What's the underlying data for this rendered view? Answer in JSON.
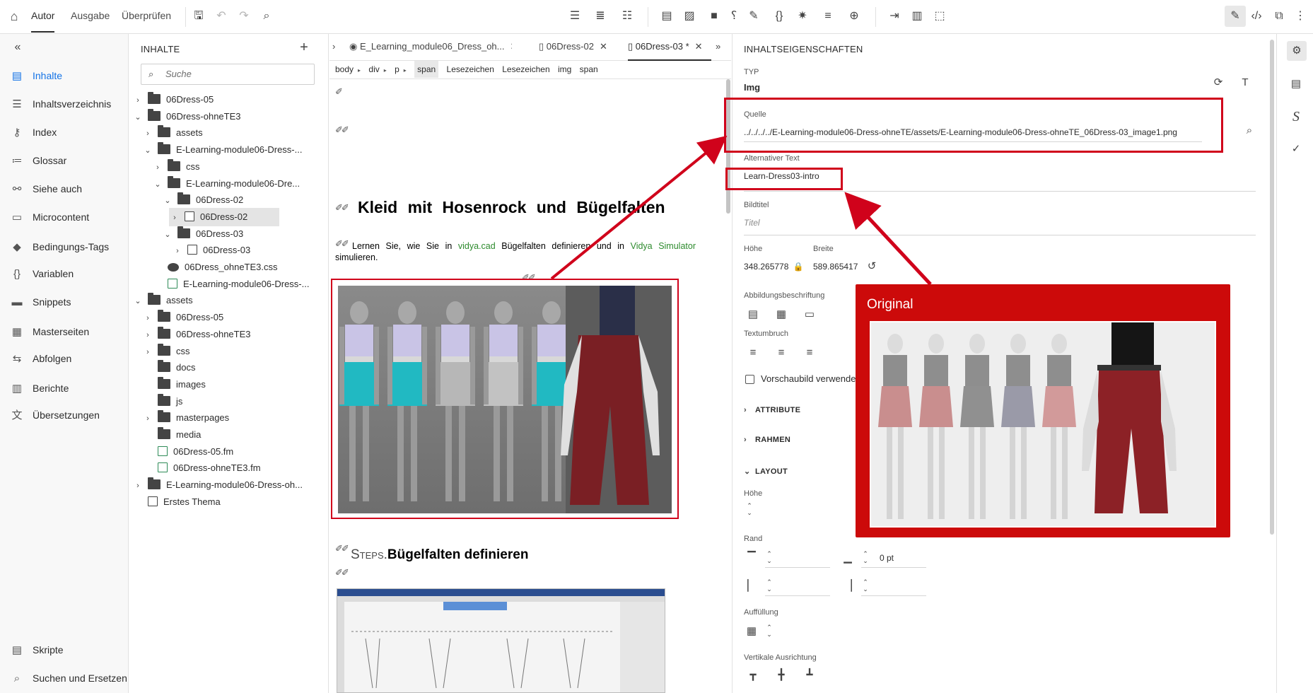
{
  "topbar": {
    "modes": [
      "Autor",
      "Ausgabe",
      "Überprüfen"
    ],
    "icons": [
      "home-icon",
      "save-icon",
      "undo-icon",
      "redo-icon",
      "find-replace-icon",
      "bullet-list-icon",
      "numbered-list-icon",
      "outdent-list-icon",
      "insert-table-icon",
      "insert-image-icon",
      "insert-video-icon",
      "insert-symbol-icon",
      "insert-link-icon",
      "insert-variable-icon",
      "insert-snippet-icon",
      "insert-gallery-icon",
      "add-circle-icon",
      "indent-icon",
      "page-layout-icon",
      "crop-icon",
      "edit-pencil-icon",
      "code-view-icon",
      "preview-icon",
      "more-icon"
    ]
  },
  "leftnav": {
    "items": [
      {
        "label": "Inhalte",
        "icon": "content-icon"
      },
      {
        "label": "Inhaltsverzeichnis",
        "icon": "toc-icon"
      },
      {
        "label": "Index",
        "icon": "key-icon"
      },
      {
        "label": "Glossar",
        "icon": "glossary-icon"
      },
      {
        "label": "Siehe auch",
        "icon": "see-also-icon"
      },
      {
        "label": "Microcontent",
        "icon": "microcontent-icon"
      },
      {
        "label": "Bedingungs-Tags",
        "icon": "tag-icon"
      },
      {
        "label": "Variablen",
        "icon": "braces-icon"
      },
      {
        "label": "Snippets",
        "icon": "snippet-icon"
      },
      {
        "label": "Masterseiten",
        "icon": "masterpage-icon"
      },
      {
        "label": "Abfolgen",
        "icon": "sequence-icon"
      },
      {
        "label": "Berichte",
        "icon": "report-icon"
      },
      {
        "label": "Übersetzungen",
        "icon": "translate-icon"
      }
    ],
    "bottom": [
      {
        "label": "Skripte",
        "icon": "script-icon"
      },
      {
        "label": "Suchen und Ersetzen",
        "icon": "search-replace-icon"
      }
    ]
  },
  "content_panel": {
    "title": "INHALTE",
    "search_placeholder": "Suche",
    "tree": [
      {
        "label": "06Dress-05",
        "depth": 0,
        "chev": "›",
        "type": "folder"
      },
      {
        "label": "06Dress-ohneTE3",
        "depth": 0,
        "chev": "⌄",
        "type": "folder"
      },
      {
        "label": "assets",
        "depth": 1,
        "chev": "›",
        "type": "folder"
      },
      {
        "label": "E-Learning-module06-Dress-...",
        "depth": 1,
        "chev": "⌄",
        "type": "folder"
      },
      {
        "label": "css",
        "depth": 2,
        "chev": "›",
        "type": "folder"
      },
      {
        "label": "E-Learning-module06-Dre...",
        "depth": 2,
        "chev": "⌄",
        "type": "folder"
      },
      {
        "label": "06Dress-02",
        "depth": 3,
        "chev": "⌄",
        "type": "folder"
      },
      {
        "label": "06Dress-02",
        "depth": 4,
        "chev": "›",
        "type": "file",
        "selected": true
      },
      {
        "label": "06Dress-03",
        "depth": 3,
        "chev": "⌄",
        "type": "folder"
      },
      {
        "label": "06Dress-03",
        "depth": 4,
        "chev": "›",
        "type": "file"
      },
      {
        "label": "06Dress_ohneTE3.css",
        "depth": 2,
        "chev": "",
        "type": "css"
      },
      {
        "label": "E-Learning-module06-Dress-...",
        "depth": 2,
        "chev": "",
        "type": "fm"
      },
      {
        "label": "assets",
        "depth": 0,
        "chev": "⌄",
        "type": "folder"
      },
      {
        "label": "06Dress-05",
        "depth": 1,
        "chev": "›",
        "type": "folder"
      },
      {
        "label": "06Dress-ohneTE3",
        "depth": 1,
        "chev": "›",
        "type": "folder"
      },
      {
        "label": "css",
        "depth": 1,
        "chev": "›",
        "type": "folder"
      },
      {
        "label": "docs",
        "depth": 1,
        "chev": "",
        "type": "folder"
      },
      {
        "label": "images",
        "depth": 1,
        "chev": "",
        "type": "folder"
      },
      {
        "label": "js",
        "depth": 1,
        "chev": "",
        "type": "folder"
      },
      {
        "label": "masterpages",
        "depth": 1,
        "chev": "›",
        "type": "folder"
      },
      {
        "label": "media",
        "depth": 1,
        "chev": "",
        "type": "folder"
      },
      {
        "label": "06Dress-05.fm",
        "depth": 1,
        "chev": "",
        "type": "fm"
      },
      {
        "label": "06Dress-ohneTE3.fm",
        "depth": 1,
        "chev": "",
        "type": "fm"
      },
      {
        "label": "E-Learning-module06-Dress-oh...",
        "depth": 0,
        "chev": "›",
        "type": "folder"
      },
      {
        "label": "Erstes Thema",
        "depth": 0,
        "chev": "",
        "type": "file"
      }
    ]
  },
  "tabs": [
    {
      "label": "E_Learning_module06_Dress_oh...",
      "active": false
    },
    {
      "label": "06Dress-02",
      "active": false
    },
    {
      "label": "06Dress-03 *",
      "active": true
    }
  ],
  "breadcrumb": [
    "body",
    "div",
    "p",
    "span",
    "Lesezeichen",
    "Lesezeichen",
    "img",
    "span"
  ],
  "editor": {
    "title": "Kleid mit Hosenrock und Bügelfalten",
    "para_before1": "Lernen Sie, wie Sie in ",
    "link1": "vidya.cad",
    "para_mid": " Bügelfalten definieren und in ",
    "link2": "Vidya Simulator",
    "para_after": " simulieren.",
    "steps_keyword": "Steps.",
    "steps_title": "Bügelfalten definieren",
    "tag_marks": "✐✐"
  },
  "properties": {
    "title": "INHALTSEIGENSCHAFTEN",
    "typ_label": "TYP",
    "typ_value": "Img",
    "quelle_label": "Quelle",
    "quelle_value": "../../../../E-Learning-module06-Dress-ohneTE/assets/E-Learning-module06-Dress-ohneTE_06Dress-03_image1.png",
    "alt_label": "Alternativer Text",
    "alt_value": "Learn-Dress03-intro",
    "bildtitel_label": "Bildtitel",
    "bildtitel_placeholder": "Titel",
    "hoehe_label": "Höhe",
    "hoehe_value": "348.265778",
    "breite_label": "Breite",
    "breite_value": "589.865417",
    "caption_label": "Abbildungsbeschriftung",
    "textumbruch_label": "Textumbruch",
    "vorschau_label": "Vorschaubild verwenden",
    "sect_attribute": "ATTRIBUTE",
    "sect_rahmen": "RAHMEN",
    "sect_layout": "LAYOUT",
    "layout_hoehe_label": "Höhe",
    "rand_label": "Rand",
    "rand_value": "0 pt",
    "auffuellung_label": "Auffüllung",
    "vert_label": "Vertikale Ausrichtung"
  },
  "annotation": {
    "title": "Original",
    "color": "#cc0a0a"
  },
  "colors": {
    "accent": "#1473e6",
    "highlight": "#d0021b",
    "link": "#2e8b2e"
  }
}
